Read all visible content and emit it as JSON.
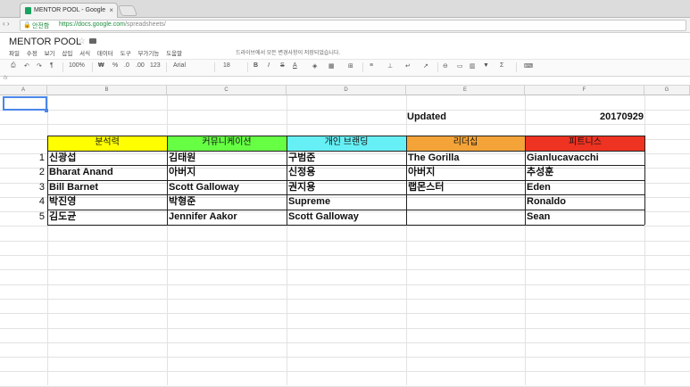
{
  "browser": {
    "tab_title": "MENTOR POOL - Google 스프",
    "tab_close": "×",
    "security_label": "안전함",
    "url_host": "https://docs.google.com",
    "url_path": "/spreadsheets/"
  },
  "sheet": {
    "title": "MENTOR POOL",
    "menu": [
      "파일",
      "수정",
      "보기",
      "삽입",
      "서식",
      "데이터",
      "도구",
      "부가기능",
      "도움말"
    ],
    "save_status": "드라이브에서 모든 변경사항이 저장되었습니다.",
    "toolbar": {
      "zoom": "100%",
      "currency": "₩",
      "percent": "%",
      "decimal_less": ".0",
      "decimal_more": ".00",
      "number_format": "123",
      "font": "Arial",
      "font_size": "18",
      "bold": "B",
      "italic": "I",
      "strike": "S",
      "text_color": "A"
    },
    "columns": [
      "A",
      "B",
      "C",
      "D",
      "E",
      "F",
      "G"
    ]
  },
  "content": {
    "updated_label": "Updated",
    "updated_value": "20170929",
    "headers": [
      {
        "label": "분석력",
        "color": "#ffff00"
      },
      {
        "label": "커뮤니케이션",
        "color": "#66ff44"
      },
      {
        "label": "개인 브랜딩",
        "color": "#66f0f5"
      },
      {
        "label": "리더십",
        "color": "#f4a338"
      },
      {
        "label": "피트니스",
        "color": "#ee3322"
      }
    ],
    "rows": [
      {
        "num": "1",
        "cells": [
          "신광섭",
          "김태원",
          "구범준",
          "The Gorilla",
          "Gianlucavacchi"
        ]
      },
      {
        "num": "2",
        "cells": [
          "Bharat Anand",
          "아버지",
          "신정용",
          "아버지",
          "추성훈"
        ]
      },
      {
        "num": "3",
        "cells": [
          "Bill Barnet",
          "Scott Galloway",
          "권지용",
          "랩몬스터",
          "Eden"
        ]
      },
      {
        "num": "4",
        "cells": [
          "박진영",
          "박형준",
          "Supreme",
          "",
          "Ronaldo"
        ]
      },
      {
        "num": "5",
        "cells": [
          "김도균",
          "Jennifer Aakor",
          "Scott Galloway",
          "",
          "Sean"
        ]
      }
    ]
  }
}
